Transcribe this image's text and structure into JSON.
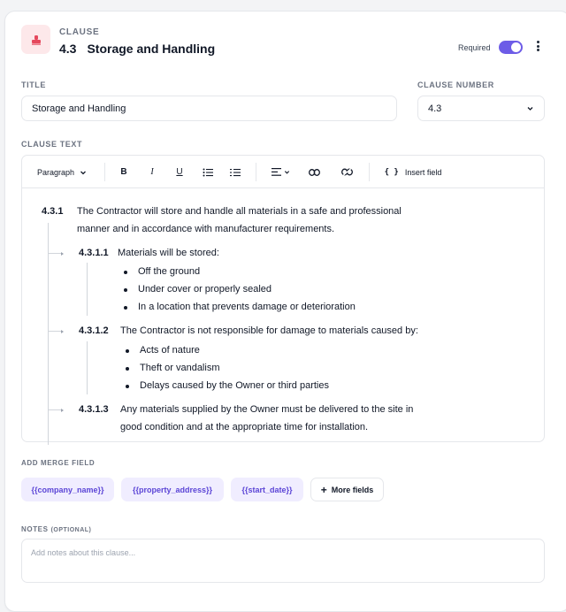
{
  "header": {
    "eyebrow": "CLAUSE",
    "clause_number": "4.3",
    "clause_title": "Storage and Handling",
    "required_label": "Required",
    "required_on": true,
    "accent_color": "#6d5ce7",
    "icon": "stamp-icon",
    "menu_icon": "more-vertical-icon"
  },
  "form": {
    "title_label": "TITLE",
    "title_value": "Storage and Handling",
    "number_label": "CLAUSE NUMBER",
    "number_value": "4.3",
    "text_label": "CLAUSE TEXT"
  },
  "toolbar": {
    "paragraph_label": "Paragraph",
    "bold": "B",
    "italic": "I",
    "underline": "U",
    "insert_field_icon": "{ }",
    "insert_field_label": "Insert field"
  },
  "content": {
    "c1_num": "4.3.1",
    "c1_line1": "The Contractor will store and handle all materials in a safe and professional",
    "c1_line2": "manner and in accordance with manufacturer requirements.",
    "c11_num": "4.3.1.1",
    "c11_text": "Materials will be stored:",
    "c11_bullets": [
      "Off the ground",
      "Under cover or properly sealed",
      "In a location that prevents damage or deterioration"
    ],
    "c12_num": "4.3.1.2",
    "c12_text": "The Contractor is not responsible for damage to materials caused by:",
    "c12_bullets": [
      "Acts of nature",
      "Theft or vandalism",
      "Delays caused by the Owner or third parties"
    ],
    "c13_num": "4.3.1.3",
    "c13_line1": "Any materials supplied by the Owner must be delivered to the site in",
    "c13_line2": "good condition and at the appropriate time for installation."
  },
  "merge": {
    "label": "ADD MERGE FIELD",
    "fields": [
      "{{company_name}}",
      "{{property_address}}",
      "{{start_date}}"
    ],
    "more_label": "More fields"
  },
  "notes": {
    "label": "NOTES",
    "optional_label": "(OPTIONAL)",
    "placeholder": "Add notes about this clause..."
  }
}
